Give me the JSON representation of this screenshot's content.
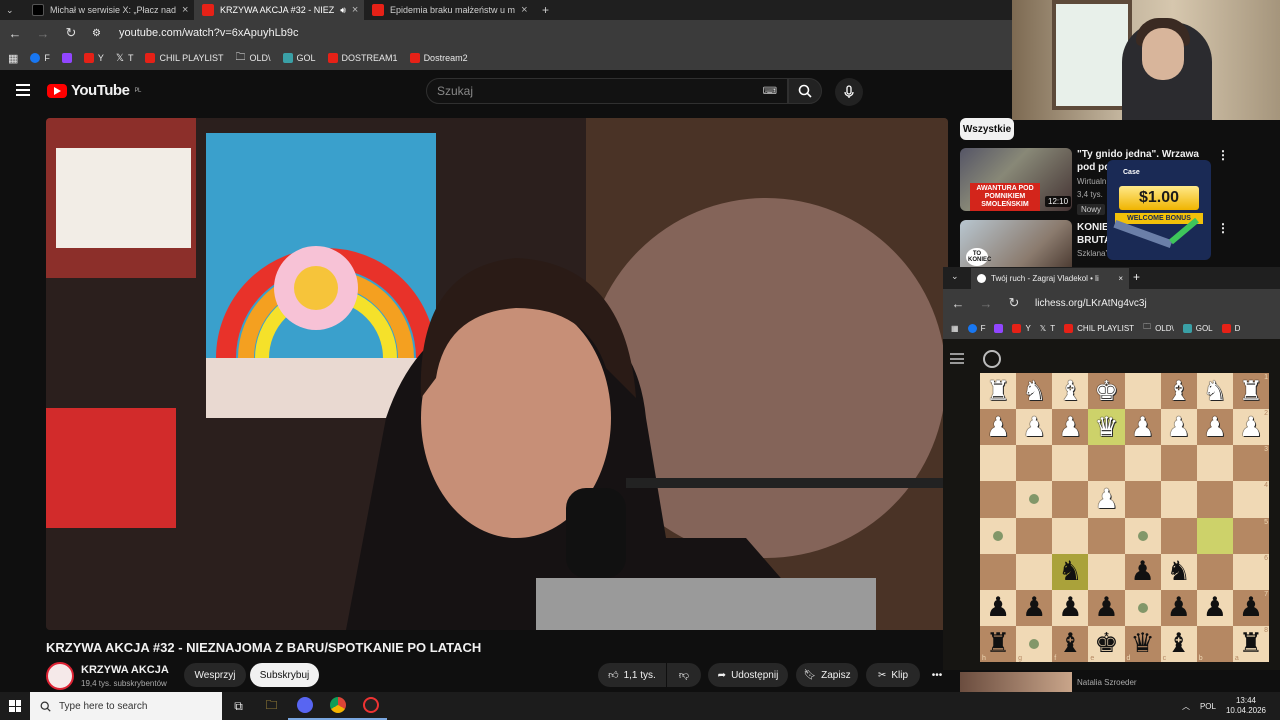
{
  "browser": {
    "tabs": [
      {
        "label": "Michał w serwisie X: „Płacz nad",
        "icon": "x-icon",
        "active": false
      },
      {
        "label": "KRZYWA AKCJA #32 - NIEZ",
        "icon": "youtube-icon",
        "active": true
      },
      {
        "label": "Epidemia braku małżeństw u m",
        "icon": "youtube-icon",
        "active": false
      }
    ],
    "url": "youtube.com/watch?v=6xApuyhLb9c",
    "bookmarks": [
      "F",
      "",
      "Y",
      "T",
      "CHIL PLAYLIST",
      "OLD\\",
      "GOL",
      "DOSTREAM1",
      "Dostream2"
    ]
  },
  "youtube": {
    "logo": "YouTube",
    "logo_country": "PL",
    "search_placeholder": "Szukaj",
    "video_title": "KRZYWA AKCJA #32 - NIEZNAJOMA Z BARU/SPOTKANIE PO LATACH",
    "channel_name": "KRZYWA AKCJA",
    "channel_subs": "19,4 tys. subskrybentów",
    "support_label": "Wesprzyj",
    "subscribe_label": "Subskrybuj",
    "like_count": "1,1 tys.",
    "share_label": "Udostępnij",
    "save_label": "Zapisz",
    "clip_label": "Klip",
    "filter_chip": "Wszystkie",
    "recommendations": [
      {
        "title": "\"Ty gnido jedna\". Wrzawa pod pomnik",
        "meta": "Wirtualn",
        "views": "3,4 tys.",
        "badge": "Nowy",
        "duration": "12:10",
        "overlay": "AWANTURA POD POMNIKIEM SMOLEŃSKIM"
      },
      {
        "title": "KONIEC BRUTA",
        "meta": "SzklanaY",
        "thumb_text": "TO KONIEC"
      }
    ],
    "footer_channel": "Natalia Szroeder"
  },
  "ad": {
    "brand": "Case",
    "amount": "$1.00",
    "bonus": "WELCOME BONUS"
  },
  "lichess": {
    "tab_title": "Twój ruch - Zagraj Vladekol • li",
    "url": "lichess.org/LKrAtNg4vc3j",
    "bookmarks": [
      "F",
      "",
      "Y",
      "T",
      "CHIL PLAYLIST",
      "OLD\\",
      "GOL",
      "D"
    ],
    "files": [
      "h",
      "g",
      "f",
      "e",
      "d",
      "c",
      "b",
      "a"
    ],
    "ranks": [
      "1",
      "2",
      "3",
      "4",
      "5",
      "6",
      "7",
      "8"
    ],
    "board": [
      [
        "wR",
        "wN",
        "wB",
        "wK",
        "",
        "wB",
        "wN",
        "wR"
      ],
      [
        "wP",
        "wP",
        "wP",
        "wQ",
        "wP",
        "wP",
        "wP",
        "wP"
      ],
      [
        "",
        "",
        "",
        "",
        "",
        "",
        "",
        ""
      ],
      [
        "",
        ".",
        "",
        "wP",
        "",
        "",
        "",
        ""
      ],
      [
        ".",
        "",
        "",
        "",
        ".",
        "",
        "",
        ""
      ],
      [
        "",
        "",
        "bN",
        "",
        "bP",
        "bN",
        "",
        ""
      ],
      [
        "bP",
        "bP",
        "bP",
        "bP",
        ".",
        "bP",
        "bP",
        "bP"
      ],
      [
        "bR",
        ".",
        "bB",
        "bK",
        "bQ",
        "bB",
        "",
        "bR"
      ]
    ],
    "highlights": [
      [
        1,
        3
      ],
      [
        4,
        6
      ],
      [
        5,
        2
      ]
    ]
  },
  "taskbar": {
    "search_placeholder": "Type here to search",
    "language": "POL",
    "time": "13:44",
    "date": "10.04.2026"
  }
}
